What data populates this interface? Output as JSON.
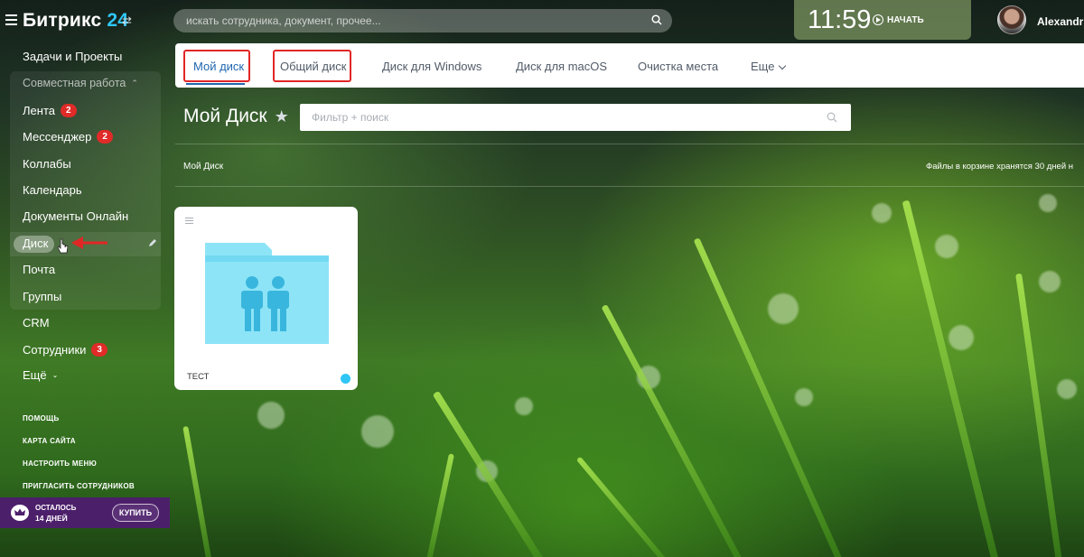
{
  "header": {
    "logo_text": "Битрикс",
    "logo_num": "24",
    "search_placeholder": "искать сотрудника, документ, прочее...",
    "time": "11:59",
    "start_label": "НАЧАТЬ",
    "username": "Alexandru"
  },
  "sidebar": {
    "items": [
      {
        "label": "Задачи и Проекты"
      },
      {
        "label": "Совместная работа"
      },
      {
        "label": "Лента",
        "badge": "2"
      },
      {
        "label": "Мессенджер",
        "badge": "2"
      },
      {
        "label": "Коллабы"
      },
      {
        "label": "Календарь"
      },
      {
        "label": "Документы Онлайн"
      },
      {
        "label": "Диск"
      },
      {
        "label": "Почта"
      },
      {
        "label": "Группы"
      },
      {
        "label": "CRM"
      },
      {
        "label": "Сотрудники",
        "badge": "3"
      },
      {
        "label": "Ещё"
      }
    ],
    "footer_links": [
      "ПОМОЩЬ",
      "КАРТА САЙТА",
      "НАСТРОИТЬ МЕНЮ",
      "ПРИГЛАСИТЬ СОТРУДНИКОВ"
    ],
    "trial": {
      "line1": "ОСТАЛОСЬ",
      "line2": "14 ДНЕЙ",
      "buy": "КУПИТЬ"
    }
  },
  "tabs": [
    {
      "label": "Мой диск"
    },
    {
      "label": "Общий диск"
    },
    {
      "label": "Диск для Windows"
    },
    {
      "label": "Диск для macOS"
    },
    {
      "label": "Очистка места"
    },
    {
      "label": "Еще"
    }
  ],
  "main": {
    "title": "Мой Диск",
    "filter_placeholder": "Фильтр + поиск",
    "breadcrumb": "Мой Диск",
    "trash_note": "Файлы в корзине хранятся 30 дней н",
    "folder_name": "ТЕСТ"
  },
  "colors": {
    "accent": "#2067b0",
    "brand": "#2fc6f6",
    "highlight": "#e12626",
    "badge": "#e02b28",
    "folder": "#8de4f7"
  }
}
